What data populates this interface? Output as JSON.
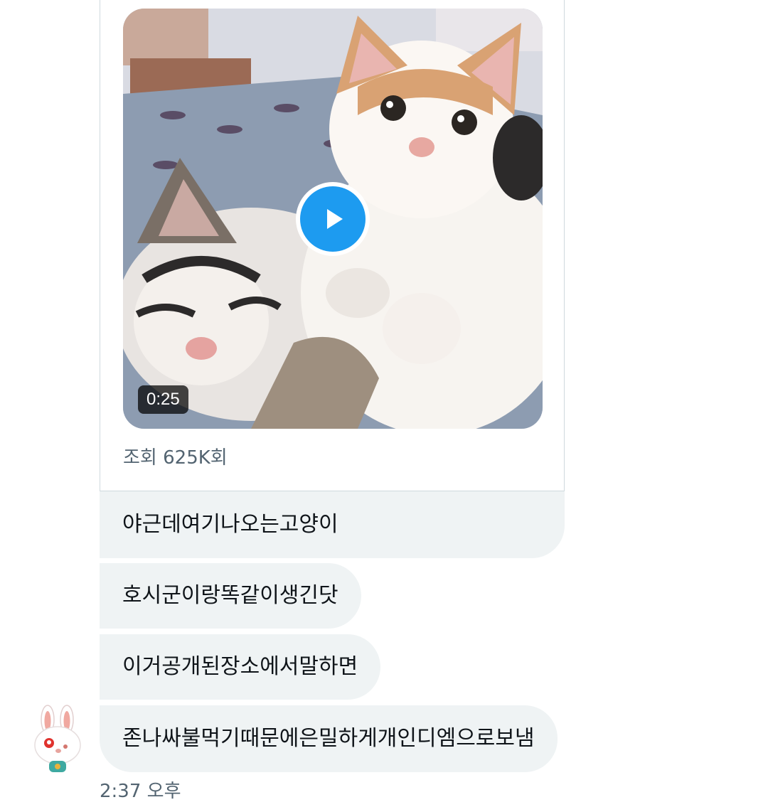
{
  "tweet_card": {
    "video": {
      "duration": "0:25",
      "icon": "play-icon"
    },
    "view_count": "조회 625K회"
  },
  "messages": [
    {
      "text": "야근데여기나오는고양이"
    },
    {
      "text": "호시군이랑똑같이생긴닷"
    },
    {
      "text": "이거공개된장소에서말하면"
    },
    {
      "text": "존나싸불먹기때문에은밀하게개인디엠으로보냄"
    }
  ],
  "avatar": {
    "icon": "bunny-avatar-icon"
  },
  "timestamp": "2:37 오후",
  "colors": {
    "bubble_bg": "#eff3f4",
    "accent": "#1d9bf0",
    "muted_text": "#536471",
    "border": "#cfd9de"
  }
}
